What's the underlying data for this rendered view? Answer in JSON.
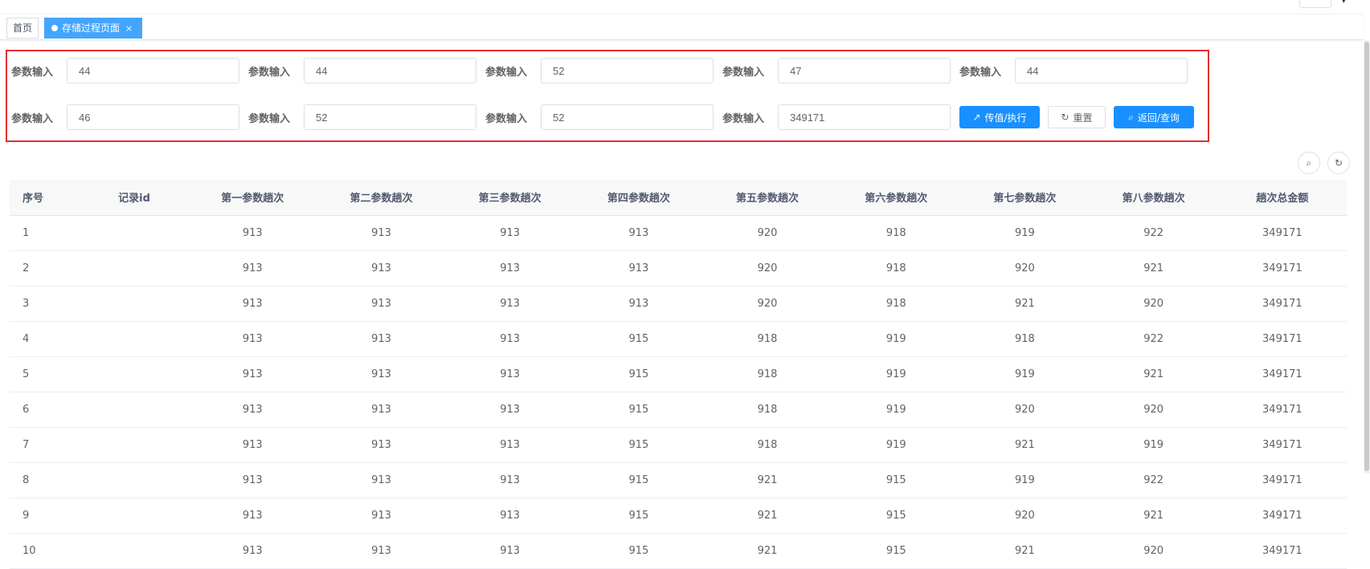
{
  "tags": {
    "home": "首页",
    "active": "存储过程页面",
    "close": "×"
  },
  "form": {
    "label": "参数输入",
    "row1": [
      "44",
      "44",
      "52",
      "47",
      "44"
    ],
    "row2": [
      "46",
      "52",
      "52",
      "349171"
    ],
    "buttons": {
      "execute": "传值/执行",
      "reset": "重置",
      "query": "返回/查询"
    }
  },
  "toolbar_icons": [
    "search-icon",
    "refresh-icon"
  ],
  "table": {
    "headers": [
      "序号",
      "记录id",
      "第一参数趟次",
      "第二参数趟次",
      "第三参数趟次",
      "第四参数趟次",
      "第五参数趟次",
      "第六参数趟次",
      "第七参数趟次",
      "第八参数趟次",
      "趟次总金额"
    ],
    "rows": [
      [
        "1",
        "",
        "913",
        "913",
        "913",
        "913",
        "920",
        "918",
        "919",
        "922",
        "349171"
      ],
      [
        "2",
        "",
        "913",
        "913",
        "913",
        "913",
        "920",
        "918",
        "920",
        "921",
        "349171"
      ],
      [
        "3",
        "",
        "913",
        "913",
        "913",
        "913",
        "920",
        "918",
        "921",
        "920",
        "349171"
      ],
      [
        "4",
        "",
        "913",
        "913",
        "913",
        "915",
        "918",
        "919",
        "918",
        "922",
        "349171"
      ],
      [
        "5",
        "",
        "913",
        "913",
        "913",
        "915",
        "918",
        "919",
        "919",
        "921",
        "349171"
      ],
      [
        "6",
        "",
        "913",
        "913",
        "913",
        "915",
        "918",
        "919",
        "920",
        "920",
        "349171"
      ],
      [
        "7",
        "",
        "913",
        "913",
        "913",
        "915",
        "918",
        "919",
        "921",
        "919",
        "349171"
      ],
      [
        "8",
        "",
        "913",
        "913",
        "913",
        "915",
        "921",
        "915",
        "919",
        "922",
        "349171"
      ],
      [
        "9",
        "",
        "913",
        "913",
        "913",
        "915",
        "921",
        "915",
        "920",
        "921",
        "349171"
      ],
      [
        "10",
        "",
        "913",
        "913",
        "913",
        "915",
        "921",
        "915",
        "921",
        "920",
        "349171"
      ]
    ]
  }
}
